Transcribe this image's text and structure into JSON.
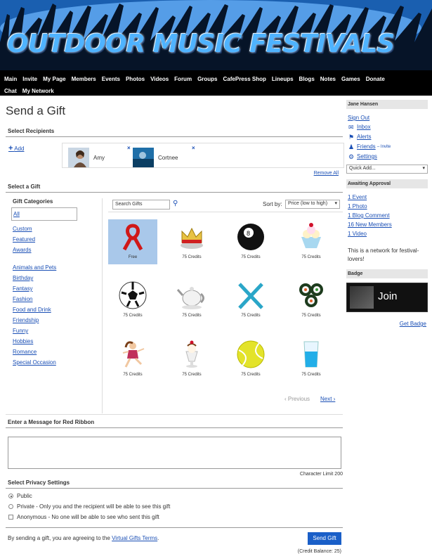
{
  "header": {
    "title": "OUTDOOR MUSIC FESTIVALS",
    "nav": [
      "Main",
      "Invite",
      "My Page",
      "Members",
      "Events",
      "Photos",
      "Videos",
      "Forum",
      "Groups",
      "CafePress Shop",
      "Lineups",
      "Blogs",
      "Notes",
      "Games",
      "Donate",
      "Chat",
      "My Network"
    ]
  },
  "page": {
    "title": "Send a Gift",
    "select_recipients": "Select Recipients",
    "add_label": "Add",
    "recipients": [
      {
        "name": "Amy"
      },
      {
        "name": "Cortnee"
      }
    ],
    "remove_all": "Remove All",
    "select_gift": "Select a Gift",
    "categories_header": "Gift Categories",
    "categories": [
      "All",
      "Custom",
      "Featured",
      "Awards",
      "Animals and Pets",
      "Birthday",
      "Fantasy",
      "Fashion",
      "Food and Drink",
      "Friendship",
      "Funny",
      "Hobbies",
      "Romance",
      "Special Occasion"
    ],
    "search_placeholder": "Search Gifts",
    "sort_label": "Sort by:",
    "sort_value": "Price (low to high)",
    "gifts": [
      {
        "name": "red-ribbon",
        "price": "Free"
      },
      {
        "name": "crown",
        "price": "75 Credits"
      },
      {
        "name": "eight-ball",
        "price": "75 Credits"
      },
      {
        "name": "ice-cream",
        "price": "75 Credits"
      },
      {
        "name": "soccer-ball",
        "price": "75 Credits"
      },
      {
        "name": "teapot",
        "price": "75 Credits"
      },
      {
        "name": "skis",
        "price": "75 Credits"
      },
      {
        "name": "sushi",
        "price": "75 Credits"
      },
      {
        "name": "figure-skater",
        "price": "75 Credits"
      },
      {
        "name": "sundae",
        "price": "75 Credits"
      },
      {
        "name": "tennis-ball",
        "price": "75 Credits"
      },
      {
        "name": "drink-glass",
        "price": "75 Credits"
      }
    ],
    "prev": "‹ Previous",
    "next": "Next ›",
    "message_header": "Enter a Message for Red Ribbon",
    "char_limit": "Character Limit 200",
    "privacy_header": "Select Privacy Settings",
    "privacy_options": [
      "Public",
      "Private - Only you and the recipient will be able to see this gift",
      "Anonymous - No one will be able to see who sent this gift"
    ],
    "terms_prefix": "By sending a gift, you are agreeing to the ",
    "terms_link": "Virtual Gifts Terms",
    "terms_suffix": ".",
    "send_button": "Send Gift",
    "credit_balance": "(Credit Balance: 25)"
  },
  "sidebar": {
    "user": "Jane Hansen",
    "sign_out": "Sign Out",
    "inbox": "Inbox",
    "alerts": "Alerts",
    "friends": "Friends",
    "invite": "– Invite",
    "settings": "Settings",
    "quick_add": "Quick Add...",
    "awaiting_header": "Awaiting Approval",
    "awaiting": [
      "1 Event",
      "1 Photo",
      "1 Blog Comment",
      "16 New Members",
      "1 Video"
    ],
    "about": "This is a network for festival-lovers!",
    "badge_header": "Badge",
    "badge_label": "Join",
    "get_badge": "Get Badge"
  }
}
